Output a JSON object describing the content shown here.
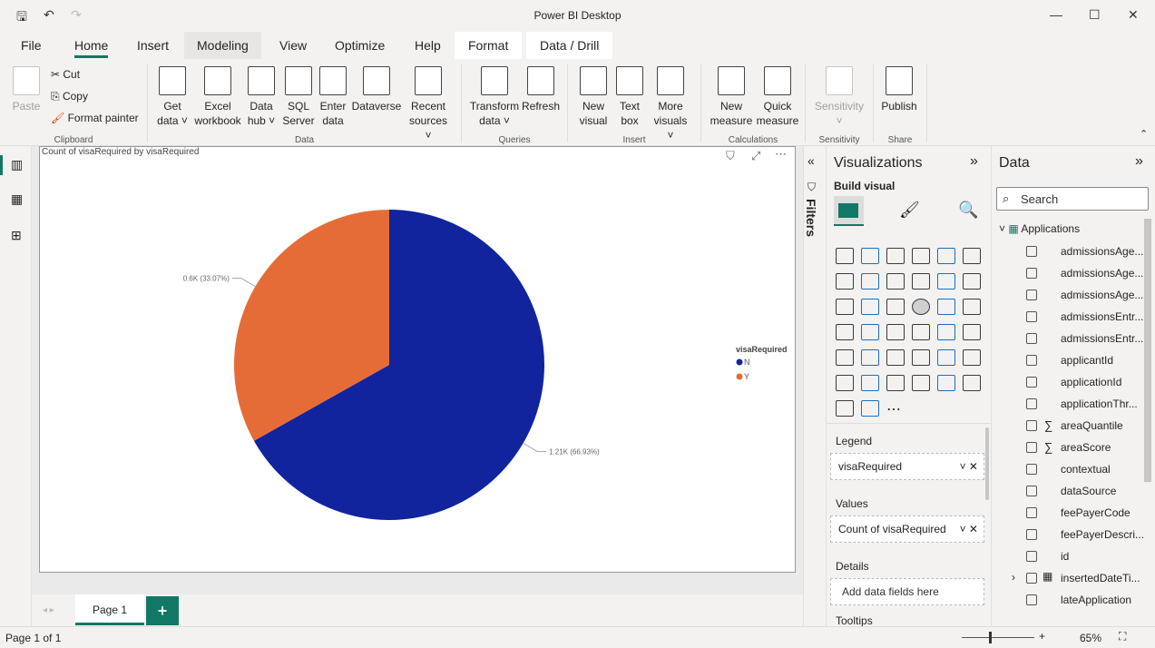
{
  "app_title": "Power BI Desktop",
  "menu_tabs": [
    "File",
    "Home",
    "Insert",
    "Modeling",
    "View",
    "Optimize",
    "Help",
    "Format",
    "Data / Drill"
  ],
  "ribbon": {
    "clipboard": {
      "paste": "Paste",
      "cut": "Cut",
      "copy": "Copy",
      "format_painter": "Format painter",
      "group": "Clipboard"
    },
    "data": {
      "buttons": [
        [
          "Get",
          "data ˅"
        ],
        [
          "Excel",
          "workbook"
        ],
        [
          "Data",
          "hub ˅"
        ],
        [
          "SQL",
          "Server"
        ],
        [
          "Enter",
          "data"
        ],
        [
          "Dataverse",
          ""
        ],
        [
          "Recent",
          "sources ˅"
        ]
      ],
      "group": "Data"
    },
    "queries": {
      "buttons": [
        [
          "Transform",
          "data ˅"
        ],
        [
          "Refresh",
          ""
        ]
      ],
      "group": "Queries"
    },
    "insert": {
      "buttons": [
        [
          "New",
          "visual"
        ],
        [
          "Text",
          "box"
        ],
        [
          "More",
          "visuals ˅"
        ]
      ],
      "group": "Insert"
    },
    "calculations": {
      "buttons": [
        [
          "New",
          "measure"
        ],
        [
          "Quick",
          "measure"
        ]
      ],
      "group": "Calculations"
    },
    "sensitivity": {
      "buttons": [
        [
          "Sensitivity",
          "˅"
        ]
      ],
      "group": "Sensitivity"
    },
    "share": {
      "buttons": [
        [
          "Publish",
          ""
        ]
      ],
      "group": "Share"
    }
  },
  "visual": {
    "title": "Count of visaRequired by visaRequired"
  },
  "chart_data": {
    "type": "pie",
    "title": "Count of visaRequired by visaRequired",
    "legend_title": "visaRequired",
    "legend_position": "right",
    "categories": [
      "N",
      "Y"
    ],
    "values": [
      1210,
      600
    ],
    "percents": [
      66.93,
      33.07
    ],
    "data_labels": [
      "1.21K (66.93%)",
      "0.6K (33.07%)"
    ],
    "colors": [
      "#12239e",
      "#e66c37"
    ]
  },
  "filters_label": "Filters",
  "visualizations": {
    "title": "Visualizations",
    "build_visual": "Build visual",
    "legend_label": "Legend",
    "legend_field": "visaRequired",
    "values_label": "Values",
    "values_field": "Count of visaRequired",
    "details_label": "Details",
    "details_placeholder": "Add data fields here",
    "tooltips_label": "Tooltips"
  },
  "data_pane": {
    "title": "Data",
    "search_placeholder": "Search",
    "table": "Applications",
    "fields": [
      {
        "name": "admissionsAge...",
        "icon": ""
      },
      {
        "name": "admissionsAge...",
        "icon": ""
      },
      {
        "name": "admissionsAge...",
        "icon": ""
      },
      {
        "name": "admissionsEntr...",
        "icon": ""
      },
      {
        "name": "admissionsEntr...",
        "icon": ""
      },
      {
        "name": "applicantId",
        "icon": ""
      },
      {
        "name": "applicationId",
        "icon": ""
      },
      {
        "name": "applicationThr...",
        "icon": ""
      },
      {
        "name": "areaQuantile",
        "icon": "sigma"
      },
      {
        "name": "areaScore",
        "icon": "sigma"
      },
      {
        "name": "contextual",
        "icon": ""
      },
      {
        "name": "dataSource",
        "icon": ""
      },
      {
        "name": "feePayerCode",
        "icon": ""
      },
      {
        "name": "feePayerDescri...",
        "icon": ""
      },
      {
        "name": "id",
        "icon": ""
      },
      {
        "name": "insertedDateTi...",
        "icon": "calendar"
      },
      {
        "name": "lateApplication",
        "icon": ""
      }
    ]
  },
  "pages": {
    "tab": "Page 1",
    "add": "+"
  },
  "status": {
    "page": "Page 1 of 1",
    "zoom": "65%"
  }
}
